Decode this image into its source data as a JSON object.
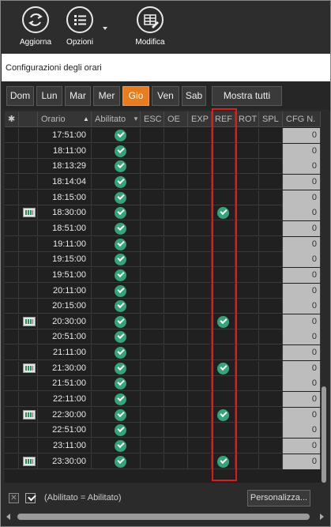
{
  "toolbar": {
    "refresh_label": "Aggiorna",
    "options_label": "Opzioni",
    "edit_label": "Modifica"
  },
  "section_title": "Configurazioni degli orari",
  "days": [
    "Dom",
    "Lun",
    "Mar",
    "Mer",
    "Gio",
    "Ven",
    "Sab"
  ],
  "active_day": "Gio",
  "show_all_label": "Mostra tutti",
  "columns": [
    "Orario",
    "Abilitato",
    "ESC",
    "OE",
    "EXP",
    "REF",
    "ROT",
    "SPL",
    "CFG N."
  ],
  "header_star": "✱",
  "rows": [
    {
      "time": "17:51:00",
      "enabled": true,
      "ref": false,
      "icon": false,
      "cfg": "0"
    },
    {
      "time": "18:11:00",
      "enabled": true,
      "ref": false,
      "icon": false,
      "cfg": "0"
    },
    {
      "time": "18:13:29",
      "enabled": true,
      "ref": false,
      "icon": false,
      "cfg": "0"
    },
    {
      "time": "18:14:04",
      "enabled": true,
      "ref": false,
      "icon": false,
      "cfg": "0"
    },
    {
      "time": "18:15:00",
      "enabled": true,
      "ref": false,
      "icon": false,
      "cfg": "0"
    },
    {
      "time": "18:30:00",
      "enabled": true,
      "ref": true,
      "icon": true,
      "cfg": "0"
    },
    {
      "time": "18:51:00",
      "enabled": true,
      "ref": false,
      "icon": false,
      "cfg": "0"
    },
    {
      "time": "19:11:00",
      "enabled": true,
      "ref": false,
      "icon": false,
      "cfg": "0"
    },
    {
      "time": "19:15:00",
      "enabled": true,
      "ref": false,
      "icon": false,
      "cfg": "0"
    },
    {
      "time": "19:51:00",
      "enabled": true,
      "ref": false,
      "icon": false,
      "cfg": "0"
    },
    {
      "time": "20:11:00",
      "enabled": true,
      "ref": false,
      "icon": false,
      "cfg": "0"
    },
    {
      "time": "20:15:00",
      "enabled": true,
      "ref": false,
      "icon": false,
      "cfg": "0"
    },
    {
      "time": "20:30:00",
      "enabled": true,
      "ref": true,
      "icon": true,
      "cfg": "0"
    },
    {
      "time": "20:51:00",
      "enabled": true,
      "ref": false,
      "icon": false,
      "cfg": "0"
    },
    {
      "time": "21:11:00",
      "enabled": true,
      "ref": false,
      "icon": false,
      "cfg": "0"
    },
    {
      "time": "21:30:00",
      "enabled": true,
      "ref": true,
      "icon": true,
      "cfg": "0"
    },
    {
      "time": "21:51:00",
      "enabled": true,
      "ref": false,
      "icon": false,
      "cfg": "0"
    },
    {
      "time": "22:11:00",
      "enabled": true,
      "ref": false,
      "icon": false,
      "cfg": "0"
    },
    {
      "time": "22:30:00",
      "enabled": true,
      "ref": true,
      "icon": true,
      "cfg": "0"
    },
    {
      "time": "22:51:00",
      "enabled": true,
      "ref": false,
      "icon": false,
      "cfg": "0"
    },
    {
      "time": "23:11:00",
      "enabled": true,
      "ref": false,
      "icon": false,
      "cfg": "0"
    },
    {
      "time": "23:30:00",
      "enabled": true,
      "ref": true,
      "icon": true,
      "cfg": "0"
    }
  ],
  "filter": {
    "close_glyph": "✕",
    "text": "(Abilitato = Abilitato)"
  },
  "customize_label": "Personalizza...",
  "colors": {
    "accent": "#e87d1e",
    "check": "#34a57a",
    "highlight": "#e01b1b"
  }
}
